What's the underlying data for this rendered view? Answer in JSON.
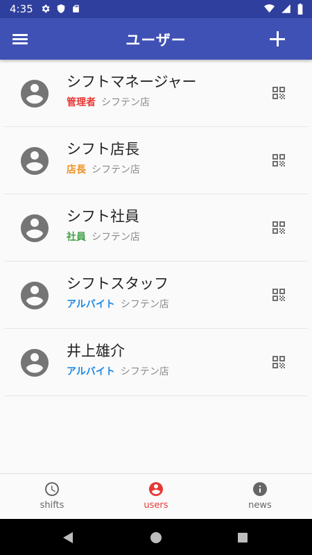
{
  "status": {
    "time": "4:35"
  },
  "header": {
    "title": "ユーザー"
  },
  "users": [
    {
      "name": "シフトマネージャー",
      "role": "管理者",
      "role_color": "#e53935",
      "store": "シフテン店"
    },
    {
      "name": "シフト店長",
      "role": "店長",
      "role_color": "#f0901e",
      "store": "シフテン店"
    },
    {
      "name": "シフト社員",
      "role": "社員",
      "role_color": "#43a047",
      "store": "シフテン店"
    },
    {
      "name": "シフトスタッフ",
      "role": "アルバイト",
      "role_color": "#1e88e5",
      "store": "シフテン店"
    },
    {
      "name": "井上雄介",
      "role": "アルバイト",
      "role_color": "#1e88e5",
      "store": "シフテン店"
    }
  ],
  "bottom_nav": {
    "items": [
      {
        "label": "shifts",
        "icon": "clock-icon",
        "active": false
      },
      {
        "label": "users",
        "icon": "account-circle-icon",
        "active": true
      },
      {
        "label": "news",
        "icon": "info-icon",
        "active": false
      }
    ]
  },
  "colors": {
    "primary": "#3f51b5",
    "status_bar": "#2f3f9e",
    "active": "#e53935"
  }
}
